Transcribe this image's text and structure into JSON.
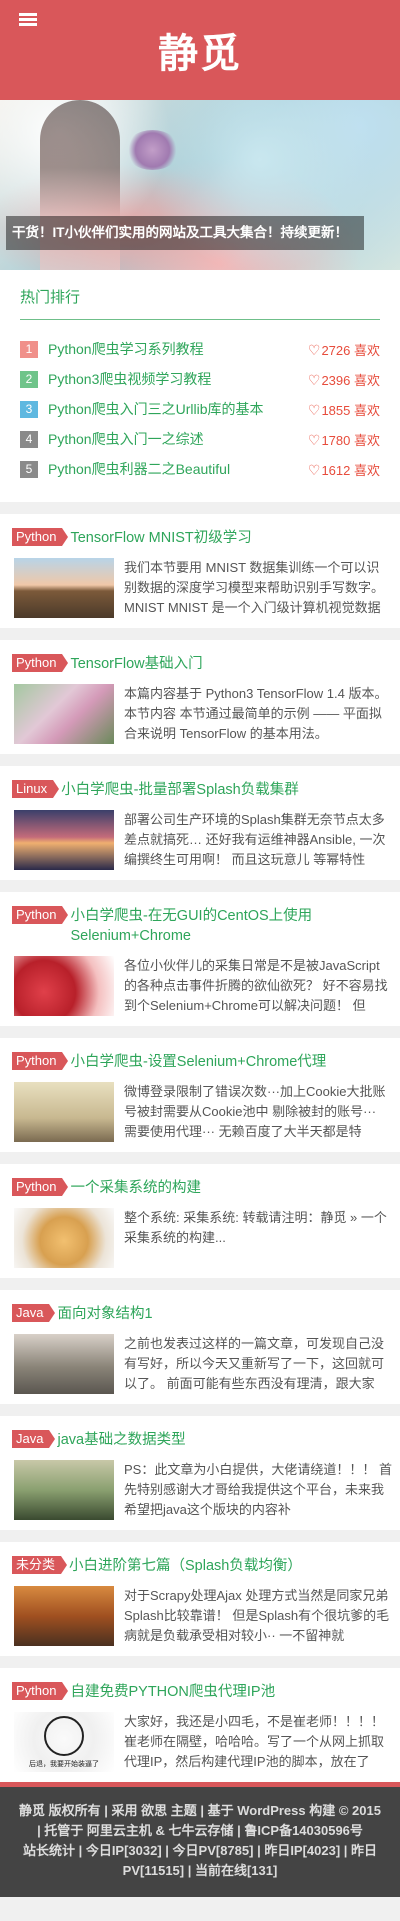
{
  "header": {
    "title": "静觅"
  },
  "banner": {
    "caption": "干货！IT小伙伴们实用的网站及工具大集合！持续更新！"
  },
  "hot": {
    "title": "热门排行",
    "items": [
      {
        "rank": "1",
        "color": "#f0908a",
        "name": "Python爬虫学习系列教程",
        "likes": "2726 喜欢"
      },
      {
        "rank": "2",
        "color": "#6fc48a",
        "name": "Python3爬虫视频学习教程",
        "likes": "2396 喜欢"
      },
      {
        "rank": "3",
        "color": "#5fb8e0",
        "name": "Python爬虫入门三之Urllib库的基本",
        "likes": "1855 喜欢"
      },
      {
        "rank": "4",
        "color": "#8a8a8a",
        "name": "Python爬虫入门一之综述",
        "likes": "1780 喜欢"
      },
      {
        "rank": "5",
        "color": "#8a8a8a",
        "name": "Python爬虫利器二之Beautiful",
        "likes": "1612 喜欢"
      }
    ]
  },
  "posts": [
    {
      "tag": "Python",
      "title": "TensorFlow MNIST初级学习",
      "excerpt": "我们本节要用 MNIST 数据集训练一个可以识别数据的深度学习模型来帮助识别手写数字。MNIST MNIST 是一个入门级计算机视觉数据"
    },
    {
      "tag": "Python",
      "title": "TensorFlow基础入门",
      "excerpt": "本篇内容基于 Python3 TensorFlow 1.4 版本。 本节内容 本节通过最简单的示例 —— 平面拟合来说明 TensorFlow 的基本用法。"
    },
    {
      "tag": "Linux",
      "title": "小白学爬虫-批量部署Splash负载集群",
      "excerpt": "部署公司生产环境的Splash集群无奈节点太多 差点就搞死… 还好我有运维神器Ansible, 一次编撰终生可用啊！ 而且这玩意儿 等幂特性"
    },
    {
      "tag": "Python",
      "title": "小白学爬虫-在无GUI的CentOS上使用Selenium+Chrome",
      "excerpt": "各位小伙伴儿的采集日常是不是被JavaScript的各种点击事件折腾的欲仙欲死？ 好不容易找到个Selenium+Chrome可以解决问题！ 但"
    },
    {
      "tag": "Python",
      "title": "小白学爬虫-设置Selenium+Chrome代理",
      "excerpt": "  微博登录限制了错误次数···加上Cookie大批账号被封需要从Cookie池中 剔除被封的账号··· 需要使用代理··· 无赖百度了大半天都是特"
    },
    {
      "tag": "Python",
      "title": "一个采集系统的构建",
      "excerpt": "整个系统: 采集系统:  转载请注明：静觅 » 一个采集系统的构建..."
    },
    {
      "tag": "Java",
      "title": "面向对象结构1",
      "excerpt": "之前也发表过这样的一篇文章，可发现自己没有写好，所以今天又重新写了一下，这回就可以了。 前面可能有些东西没有理清，跟大家"
    },
    {
      "tag": "Java",
      "title": "java基础之数据类型",
      "excerpt": "PS：此文章为小白提供，大佬请绕道！！！ 首先特别感谢大才哥给我提供这个平台，未来我希望把java这个版块的内容补"
    },
    {
      "tag": "未分类",
      "title": "小白进阶第七篇（Splash负载均衡）",
      "excerpt": "对于Scrapy处理Ajax 处理方式当然是同家兄弟Splash比较靠谱！ 但是Splash有个很坑爹的毛病就是负载承受相对较小·· 一不留神就"
    },
    {
      "tag": "Python",
      "title": "自建免费PYTHON爬虫代理IP池",
      "excerpt": "大家好，我还是小四毛，不是崔老师！！！！崔老师在隔壁，哈哈哈。写了一个从网上抓取代理IP，然后构建代理IP池的脚本，放在了",
      "thumb_caption": "后退，我要开始装逼了"
    }
  ],
  "footer": {
    "line1": "静觅 版权所有 | 采用 欲思 主题 | 基于 WordPress 构建 © 2015 | 托管于 阿里云主机 & 七牛云存储 | 鲁ICP备14030596号",
    "line2": "站长统计 | 今日IP[3032] | 今日PV[8785] | 昨日IP[4023] | 昨日PV[11515] | 当前在线[131]"
  }
}
